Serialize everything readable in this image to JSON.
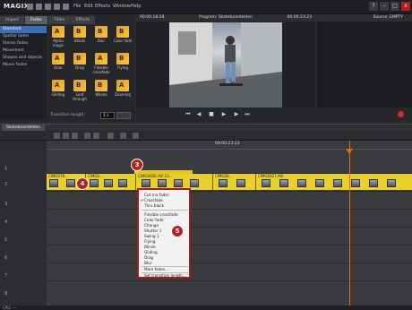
{
  "app": {
    "logo": "MAGIX"
  },
  "menu": [
    "File",
    "Edit",
    "Effects",
    "Window",
    "Help"
  ],
  "window_buttons": [
    "?",
    "–",
    "□",
    "x"
  ],
  "media_pool": {
    "tabs": [
      "Import",
      "Fades",
      "Titles",
      "Effects"
    ],
    "active_tab": "Fades",
    "categories": [
      "Standard",
      "Spatial fades",
      "Stereo fades",
      "Movement",
      "Shapes and objects",
      "Movie fades"
    ],
    "active_category": "Standard",
    "fades": [
      {
        "label": "Alpha magic",
        "letter": "A"
      },
      {
        "label": "Blinds",
        "letter": "B"
      },
      {
        "label": "Blur",
        "letter": "B"
      },
      {
        "label": "Color fade",
        "letter": "B"
      },
      {
        "label": "Door",
        "letter": "A"
      },
      {
        "label": "Drag",
        "letter": "B"
      },
      {
        "label": "Flexible crossfade",
        "letter": "A"
      },
      {
        "label": "Flying",
        "letter": "B"
      },
      {
        "label": "Gliding",
        "letter": "A"
      },
      {
        "label": "Leaf through",
        "letter": "B"
      },
      {
        "label": "Waves",
        "letter": "B"
      },
      {
        "label": "Zooming",
        "letter": "A"
      }
    ],
    "transition_length": {
      "label": "Transition length:",
      "value": "1 s"
    }
  },
  "program_monitor": {
    "timecode_left": "00:00:18:28",
    "title": "Program: Skateboardelden",
    "timecode_right": "00:00:23:23",
    "timecode_center": "23:03"
  },
  "source_monitor": {
    "label": "Source: EMPTY"
  },
  "timeline": {
    "arrangement_tab": "Skateboardelden",
    "ruler_timecode": "00:00:23:23",
    "track_numbers": [
      "1",
      "2",
      "3",
      "4",
      "5",
      "6",
      "7",
      "8"
    ],
    "clips": [
      "CIMG078...",
      "CIMG0...",
      "CIMG0826.AVI 23...",
      "CIMG08...",
      "CIMG0927.AVI"
    ]
  },
  "badges": [
    "3",
    "4",
    "5"
  ],
  "context_menu": {
    "group1": [
      "Cut (no fade)",
      "Crossfade",
      "Thru black"
    ],
    "checked": "Crossfade",
    "group2": [
      "Flexible crossfade",
      "Color fade",
      "Change",
      "Shutter 1",
      "Swing 1",
      "Flying",
      "Blinds",
      "Gliding",
      "Drag",
      "Blur"
    ],
    "more": "More fades...",
    "set_length": "Set transition length..."
  },
  "status": {
    "text": "CPU: —"
  },
  "colors": {
    "accent": "#3a6fb8",
    "clip": "#e8cf2a",
    "badge": "#b32121",
    "playhead": "#e86a10"
  }
}
